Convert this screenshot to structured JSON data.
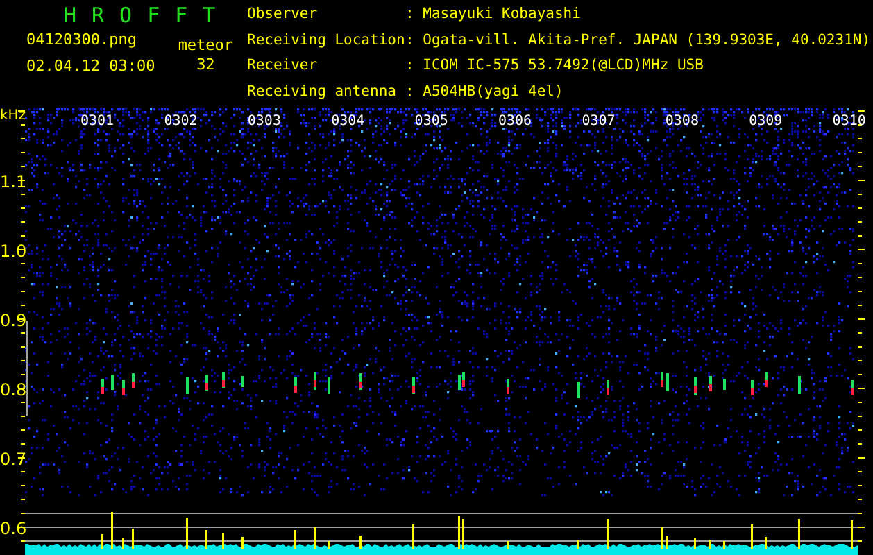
{
  "header": {
    "title": "HROFFT",
    "file_name": "04120300.png",
    "timestamp": "02.04.12 03:00",
    "count_label": "meteor",
    "count": "32",
    "info": [
      {
        "label": "Observer",
        "value": ": Masayuki Kobayashi"
      },
      {
        "label": "Receiving Location",
        "value": ": Ogata-vill. Akita-Pref. JAPAN (139.9303E, 40.0231N)"
      },
      {
        "label": "Receiver",
        "value": ": ICOM IC-575 53.7492(@LCD)MHz USB"
      },
      {
        "label": "Receiving antenna",
        "value": ": A504HB(yagi 4el)"
      }
    ]
  },
  "plot": {
    "y_unit": "kHz",
    "y_labels": [
      "1.1",
      "1.0",
      "0.9",
      "0.8",
      "0.7",
      "0.6"
    ],
    "x_labels": [
      "0301",
      "0302",
      "0303",
      "0304",
      "0305",
      "0306",
      "0307",
      "0308",
      "0309",
      "0310"
    ]
  }
}
